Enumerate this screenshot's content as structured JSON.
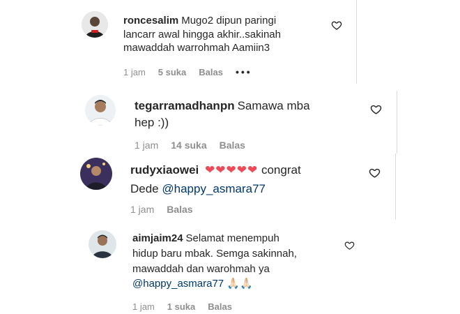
{
  "comments": [
    {
      "username": "roncesalim",
      "line1": "Mugo2 dipun paringi",
      "line2": "lancarr awal hingga akhir..sakinah",
      "line3": "mawaddah warrohmah Aamiin3",
      "time": "1 jam",
      "likes": "5 suka",
      "reply": "Balas",
      "more": "•••"
    },
    {
      "username": "tegarramadhanpn",
      "line1": "Samawa mba",
      "line2": "hep :))",
      "time": "1 jam",
      "likes": "14 suka",
      "reply": "Balas"
    },
    {
      "username": "rudyxiaowei",
      "hearts": "❤❤❤❤❤",
      "line1": "congrat",
      "line2_prefix": "Dede",
      "mention": "@happy_asmara77",
      "time": "1 jam",
      "reply": "Balas"
    },
    {
      "username": "aimjaim24",
      "line1": "Selamat menempuh",
      "line2": "hidup baru mbak. Semga sakinnah,",
      "line3": "mawaddah dan warohmah ya",
      "mention": "@happy_asmara77",
      "emoji": "🙏🏻🙏🏻",
      "time": "1 jam",
      "likes": "1 suka",
      "reply": "Balas"
    }
  ],
  "icons": {
    "like": "heart-outline-icon"
  },
  "colors": {
    "mention": "#00376b",
    "meta": "#8e8e8e",
    "heart": "#ed4956"
  }
}
